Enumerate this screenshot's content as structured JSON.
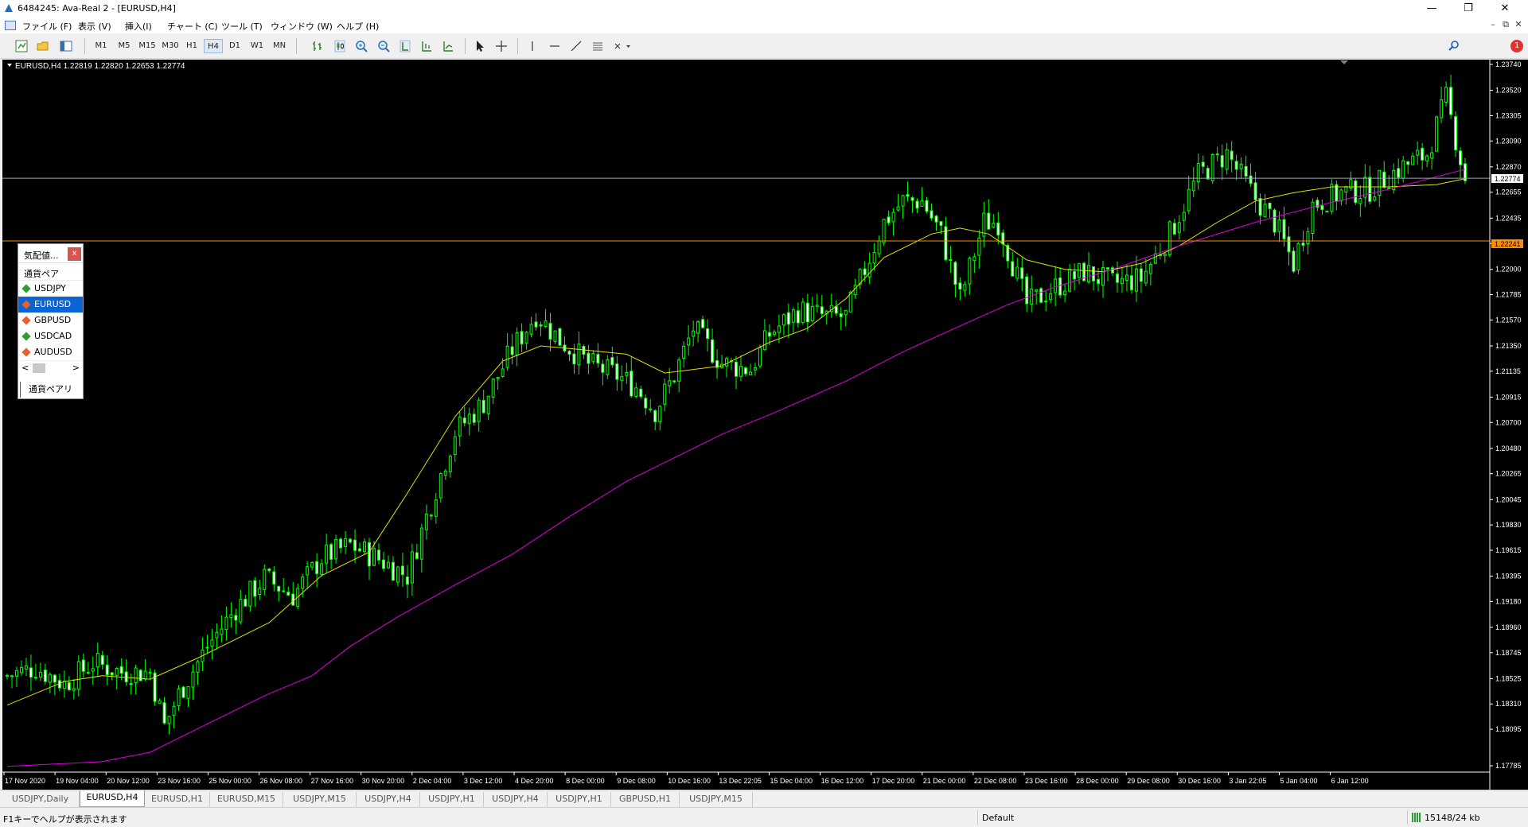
{
  "window": {
    "title": "6484245: Ava-Real 2 - [EURUSD,H4]",
    "minimize": "—",
    "restore": "❐",
    "close": "✕"
  },
  "menu": {
    "items": [
      "ファイル (F)",
      "表示 (V)",
      "挿入(I)",
      "チャート (C)",
      "ツール (T)",
      "ウィンドウ (W)",
      "ヘルプ (H)"
    ],
    "mdi_min": "–",
    "mdi_restore": "⧉",
    "mdi_close": "✕"
  },
  "toolbar": {
    "timeframes": [
      "M1",
      "M5",
      "M15",
      "M30",
      "H1",
      "H4",
      "D1",
      "W1",
      "MN"
    ],
    "active_timeframe": "H4",
    "notification_count": "1"
  },
  "chart": {
    "info_label": "EURUSD,H4  1.22819 1.22820 1.22653 1.22774",
    "current_price_label": "1.22774",
    "hline_price_label": "1.22241",
    "colors": {
      "bull": "#00ff00",
      "bear": "#ffffff",
      "ma_fast": "#e0e000",
      "ma_slow": "#e000e0",
      "hline": "#ff8c00",
      "price_line": "#9aa6b2"
    }
  },
  "chart_data": {
    "type": "candlestick",
    "symbol": "EURUSD",
    "timeframe": "H4",
    "ylim": [
      1.17785,
      1.2374
    ],
    "y_ticks": [
      "1.23740",
      "1.23520",
      "1.23305",
      "1.23090",
      "1.22870",
      "1.22655",
      "1.22435",
      "1.22220",
      "1.22000",
      "1.21785",
      "1.21570",
      "1.21350",
      "1.21135",
      "1.20915",
      "1.20700",
      "1.20480",
      "1.20265",
      "1.20045",
      "1.19830",
      "1.19615",
      "1.19395",
      "1.19180",
      "1.18960",
      "1.18745",
      "1.18525",
      "1.18310",
      "1.18095",
      "1.17785"
    ],
    "x_ticks": [
      "17 Nov 2020",
      "19 Nov 04:00",
      "20 Nov 12:00",
      "23 Nov 16:00",
      "25 Nov 00:00",
      "26 Nov 08:00",
      "27 Nov 16:00",
      "30 Nov 20:00",
      "2 Dec 04:00",
      "3 Dec 12:00",
      "4 Dec 20:00",
      "8 Dec 00:00",
      "9 Dec 08:00",
      "10 Dec 16:00",
      "13 Dec 22:05",
      "15 Dec 04:00",
      "16 Dec 12:00",
      "17 Dec 20:00",
      "21 Dec 00:00",
      "22 Dec 08:00",
      "23 Dec 16:00",
      "28 Dec 00:00",
      "29 Dec 08:00",
      "30 Dec 16:00",
      "3 Jan 22:05",
      "5 Jan 04:00",
      "6 Jan 12:00"
    ],
    "close_path": [
      [
        0,
        1.1855
      ],
      [
        6,
        1.1862
      ],
      [
        12,
        1.1848
      ],
      [
        18,
        1.1866
      ],
      [
        24,
        1.1858
      ],
      [
        30,
        1.1858
      ],
      [
        33,
        1.1812
      ],
      [
        36,
        1.1839
      ],
      [
        42,
        1.188
      ],
      [
        48,
        1.1912
      ],
      [
        54,
        1.1938
      ],
      [
        60,
        1.1923
      ],
      [
        66,
        1.1955
      ],
      [
        72,
        1.1966
      ],
      [
        78,
        1.1954
      ],
      [
        84,
        1.194
      ],
      [
        88,
        1.199
      ],
      [
        94,
        1.2062
      ],
      [
        100,
        1.2087
      ],
      [
        106,
        1.2132
      ],
      [
        111,
        1.2162
      ],
      [
        116,
        1.214
      ],
      [
        122,
        1.212
      ],
      [
        128,
        1.211
      ],
      [
        132,
        1.21
      ],
      [
        136,
        1.208
      ],
      [
        140,
        1.211
      ],
      [
        144,
        1.215
      ],
      [
        150,
        1.212
      ],
      [
        156,
        1.2115
      ],
      [
        160,
        1.2145
      ],
      [
        166,
        1.2165
      ],
      [
        172,
        1.216
      ],
      [
        176,
        1.216
      ],
      [
        180,
        1.22
      ],
      [
        184,
        1.224
      ],
      [
        188,
        1.2258
      ],
      [
        192,
        1.2258
      ],
      [
        196,
        1.223
      ],
      [
        200,
        1.2175
      ],
      [
        205,
        1.224
      ],
      [
        208,
        1.224
      ],
      [
        214,
        1.217
      ],
      [
        220,
        1.2185
      ],
      [
        226,
        1.2198
      ],
      [
        232,
        1.2188
      ],
      [
        238,
        1.2192
      ],
      [
        244,
        1.223
      ],
      [
        250,
        1.228
      ],
      [
        256,
        1.2298
      ],
      [
        262,
        1.226
      ],
      [
        266,
        1.224
      ],
      [
        270,
        1.2205
      ],
      [
        274,
        1.2255
      ],
      [
        280,
        1.2265
      ],
      [
        286,
        1.2268
      ],
      [
        292,
        1.2285
      ],
      [
        298,
        1.2298
      ],
      [
        302,
        1.2345
      ],
      [
        306,
        1.2277
      ]
    ],
    "series": [
      {
        "name": "MA",
        "values": [
          [
            0,
            1.183
          ],
          [
            12,
            1.185
          ],
          [
            20,
            1.1855
          ],
          [
            30,
            1.1852
          ],
          [
            40,
            1.187
          ],
          [
            55,
            1.19
          ],
          [
            66,
            1.194
          ],
          [
            76,
            1.196
          ],
          [
            84,
            1.201
          ],
          [
            94,
            1.2075
          ],
          [
            104,
            1.2122
          ],
          [
            112,
            1.2135
          ],
          [
            120,
            1.2132
          ],
          [
            130,
            1.2128
          ],
          [
            138,
            1.2112
          ],
          [
            150,
            1.2118
          ],
          [
            160,
            1.2138
          ],
          [
            168,
            1.215
          ],
          [
            176,
            1.2175
          ],
          [
            184,
            1.221
          ],
          [
            194,
            1.223
          ],
          [
            200,
            1.2235
          ],
          [
            206,
            1.223
          ],
          [
            214,
            1.2208
          ],
          [
            222,
            1.22
          ],
          [
            230,
            1.2198
          ],
          [
            238,
            1.2205
          ],
          [
            246,
            1.222
          ],
          [
            254,
            1.224
          ],
          [
            262,
            1.2258
          ],
          [
            270,
            1.2265
          ],
          [
            278,
            1.227
          ],
          [
            290,
            1.227
          ],
          [
            300,
            1.2272
          ],
          [
            306,
            1.2277
          ]
        ]
      },
      {
        "name": "MA",
        "values": [
          [
            0,
            1.1778
          ],
          [
            20,
            1.1782
          ],
          [
            30,
            1.179
          ],
          [
            40,
            1.181
          ],
          [
            54,
            1.1838
          ],
          [
            64,
            1.1855
          ],
          [
            72,
            1.188
          ],
          [
            82,
            1.1905
          ],
          [
            94,
            1.1932
          ],
          [
            106,
            1.1958
          ],
          [
            118,
            1.199
          ],
          [
            130,
            1.202
          ],
          [
            140,
            1.204
          ],
          [
            150,
            1.206
          ],
          [
            162,
            1.208
          ],
          [
            176,
            1.2105
          ],
          [
            188,
            1.213
          ],
          [
            200,
            1.2152
          ],
          [
            210,
            1.217
          ],
          [
            220,
            1.2185
          ],
          [
            232,
            1.22
          ],
          [
            246,
            1.222
          ],
          [
            262,
            1.224
          ],
          [
            276,
            1.2255
          ],
          [
            290,
            1.2268
          ],
          [
            306,
            1.2285
          ]
        ]
      }
    ],
    "bar_count": 307
  },
  "market_watch": {
    "title": "気配値...",
    "close": "x",
    "column_header": "通貨ペア",
    "symbols": [
      {
        "name": "USDJPY",
        "dir": "up",
        "color": "#2e9e2e"
      },
      {
        "name": "EURUSD",
        "dir": "down",
        "color": "#e5602b"
      },
      {
        "name": "GBPUSD",
        "dir": "down",
        "color": "#e5602b"
      },
      {
        "name": "USDCAD",
        "dir": "up",
        "color": "#2e9e2e"
      },
      {
        "name": "AUDUSD",
        "dir": "down",
        "color": "#e5602b"
      }
    ],
    "selected": "EURUSD",
    "scroll_left": "<",
    "scroll_right": ">",
    "tab_label": "通貨ペアリスト"
  },
  "chart_tabs": [
    "USDJPY,Daily",
    "EURUSD,H4",
    "EURUSD,H1",
    "EURUSD,M15",
    "USDJPY,M15",
    "USDJPY,H4",
    "USDJPY,H1",
    "USDJPY,H4",
    "USDJPY,H1",
    "GBPUSD,H1",
    "USDJPY,M15"
  ],
  "active_chart_tab": "EURUSD,H4",
  "status": {
    "help": "F1キーでヘルプが表示されます",
    "profile": "Default",
    "connection": "15148/24 kb"
  }
}
